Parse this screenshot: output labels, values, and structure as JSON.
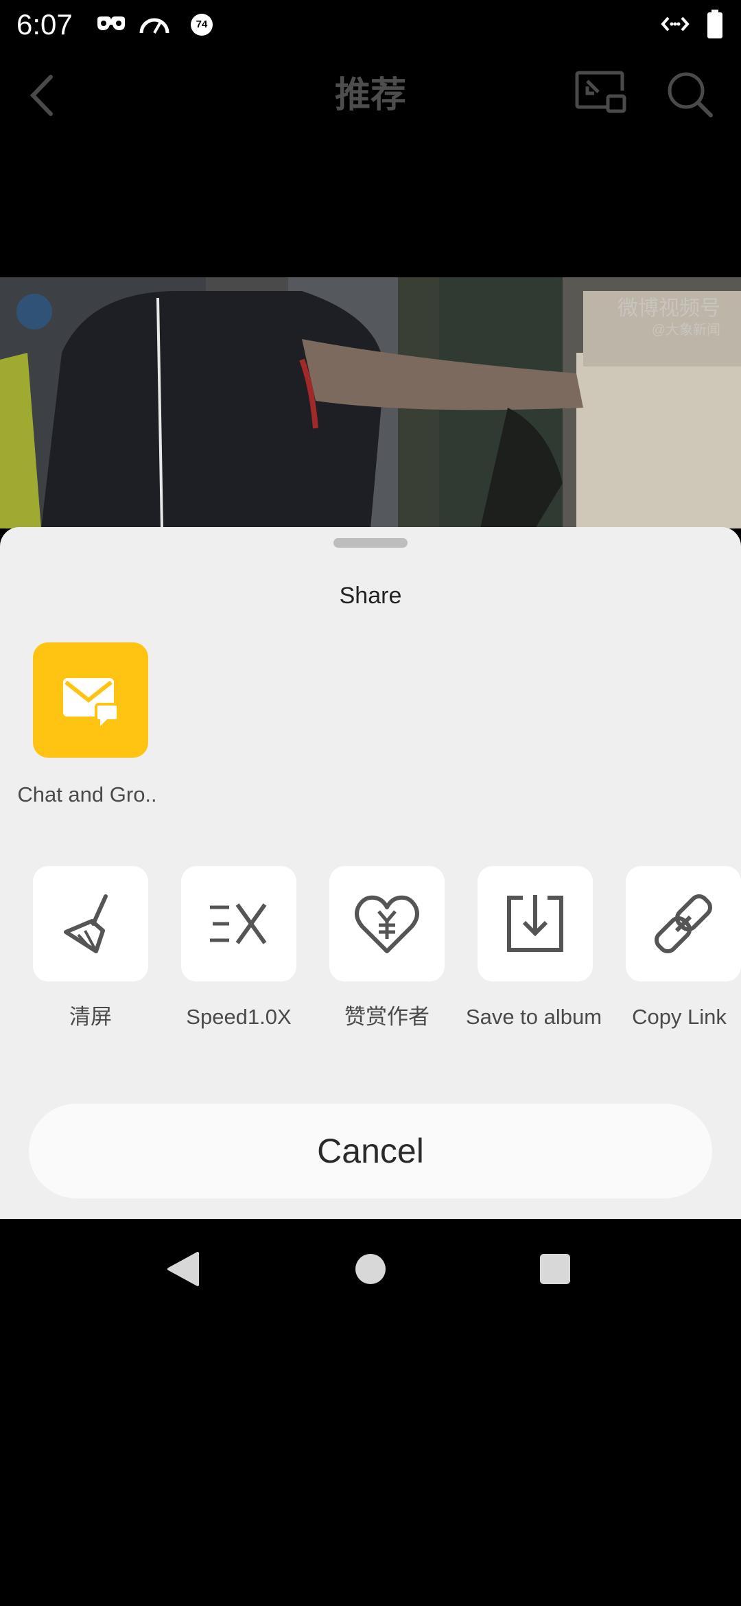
{
  "status_bar": {
    "time": "6:07",
    "battery_badge": "74",
    "icons": [
      "incognito-icon",
      "speedometer-icon",
      "badge-icon",
      "data-transfer-icon",
      "battery-icon"
    ]
  },
  "header": {
    "title": "推荐",
    "back_icon": "chevron-left-icon",
    "pip_icon": "picture-in-picture-icon",
    "search_icon": "search-icon"
  },
  "video": {
    "watermark_right": "微博视频号",
    "watermark_right_sub": "@大象新闻"
  },
  "share_sheet": {
    "title": "Share",
    "targets": [
      {
        "label": "Chat and Gro..",
        "icon": "mail-chat-icon",
        "color": "#FFC412"
      }
    ],
    "actions": [
      {
        "label": "清屏",
        "icon": "broom-icon"
      },
      {
        "label": "Speed1.0X",
        "icon": "speed-icon"
      },
      {
        "label": "赞赏作者",
        "icon": "heart-yen-icon"
      },
      {
        "label": "Save to album",
        "icon": "download-icon"
      },
      {
        "label": "Copy Link",
        "icon": "link-icon"
      }
    ],
    "cancel_label": "Cancel"
  },
  "nav_bar": {
    "icons": [
      "back-triangle-icon",
      "home-circle-icon",
      "recents-square-icon"
    ]
  }
}
